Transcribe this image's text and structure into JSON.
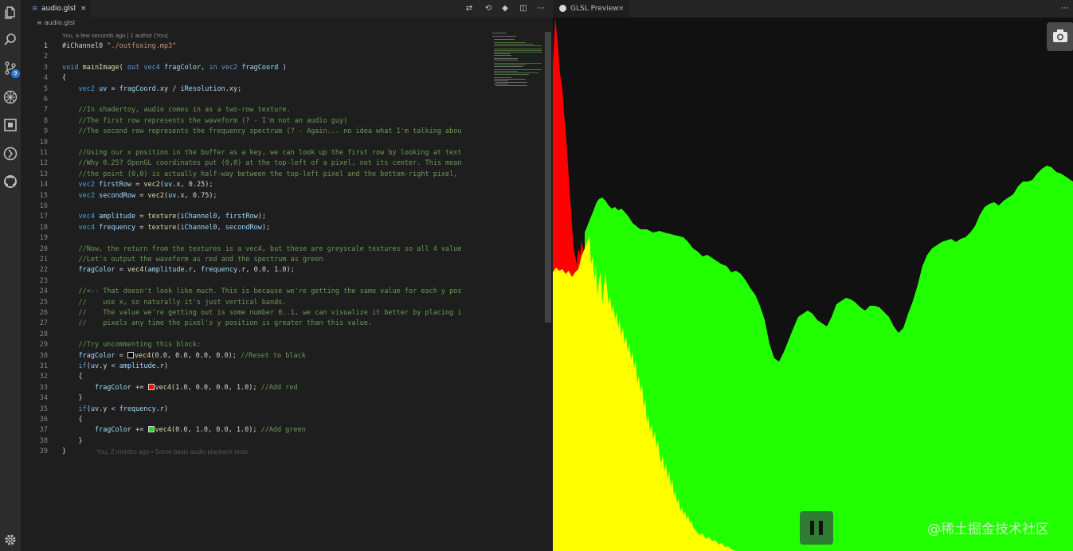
{
  "editor": {
    "tab": {
      "label": "audio.glsl",
      "close": "×"
    },
    "breadcrumb": "audio.glsl",
    "blame": "You, a few seconds ago | 1 author (You)",
    "inline_blame": "You, 2 months ago • Some basic audio playback tests",
    "code_lines": [
      {
        "n": "1",
        "html": "#iChannel0 <span class=\"st\">\"./outfoxing.mp3\"</span>"
      },
      {
        "n": "2",
        "html": ""
      },
      {
        "n": "3",
        "html": "<span class=\"kw\">void</span> <span class=\"fn\">mainImage</span>( <span class=\"kw\">out</span> <span class=\"kw\">vec4</span> <span class=\"vr\">fragColor</span>, <span class=\"kw\">in</span> <span class=\"kw\">vec2</span> <span class=\"vr\">fragCoord</span> )"
      },
      {
        "n": "4",
        "html": "{"
      },
      {
        "n": "5",
        "html": "    <span class=\"kw\">vec2</span> <span class=\"vr\">uv</span> = <span class=\"vr\">fragCoord</span>.xy / <span class=\"vr\">iResolution</span>.xy;"
      },
      {
        "n": "6",
        "html": ""
      },
      {
        "n": "7",
        "html": "    <span class=\"cm\">//In shadertoy, audio comes in as a two-row texture.</span>"
      },
      {
        "n": "8",
        "html": "    <span class=\"cm\">//The first row represents the waveform (? - I'm not an audio guy)</span>"
      },
      {
        "n": "9",
        "html": "    <span class=\"cm\">//The second row represents the frequency spectrum (? - Again... no idea what I'm talking abou</span>"
      },
      {
        "n": "10",
        "html": ""
      },
      {
        "n": "11",
        "html": "    <span class=\"cm\">//Using our x position in the buffer as a key, we can look up the first row by looking at text</span>"
      },
      {
        "n": "12",
        "html": "    <span class=\"cm\">//Why 0.25? OpenGL coordinates put (0,0) at the top-left of a pixel, not its center. This mean</span>"
      },
      {
        "n": "13",
        "html": "    <span class=\"cm\">//the point (0,0) is actually half-way between the top-left pixel and the bottom-right pixel, </span>"
      },
      {
        "n": "14",
        "html": "    <span class=\"kw\">vec2</span> <span class=\"vr\">firstRow</span> = <span class=\"fn\">vec2</span>(<span class=\"vr\">uv</span>.x, 0.25);"
      },
      {
        "n": "15",
        "html": "    <span class=\"kw\">vec2</span> <span class=\"vr\">secondRow</span> = <span class=\"fn\">vec2</span>(<span class=\"vr\">uv</span>.x, 0.75);"
      },
      {
        "n": "16",
        "html": ""
      },
      {
        "n": "17",
        "html": "    <span class=\"kw\">vec4</span> <span class=\"vr\">amplitude</span> = <span class=\"fn\">texture</span>(<span class=\"vr\">iChannel0</span>, <span class=\"vr\">firstRow</span>);"
      },
      {
        "n": "18",
        "html": "    <span class=\"kw\">vec4</span> <span class=\"vr\">frequency</span> = <span class=\"fn\">texture</span>(<span class=\"vr\">iChannel0</span>, <span class=\"vr\">secondRow</span>);"
      },
      {
        "n": "19",
        "html": ""
      },
      {
        "n": "20",
        "html": "    <span class=\"cm\">//Now, the return from the textures is a vec4, but these are greyscale textures so all 4 value</span>"
      },
      {
        "n": "21",
        "html": "    <span class=\"cm\">//Let's output the waveform as red and the spectrum as green</span>"
      },
      {
        "n": "22",
        "html": "    <span class=\"vr\">fragColor</span> = <span class=\"fn\">vec4</span>(<span class=\"vr\">amplitude</span>.r, <span class=\"vr\">frequency</span>.r, 0.0, 1.0);"
      },
      {
        "n": "23",
        "html": ""
      },
      {
        "n": "24",
        "html": "    <span class=\"cm\">//<-- That doesn't look like much. This is because we're getting the same value for each y pos</span>"
      },
      {
        "n": "25",
        "html": "    <span class=\"cm\">//    use x, so naturally it's just vertical bands.</span>"
      },
      {
        "n": "26",
        "html": "    <span class=\"cm\">//    The value we're getting out is some number 0..1, we can visualize it better by placing i</span>"
      },
      {
        "n": "27",
        "html": "    <span class=\"cm\">//    pixels any time the pixel's y position is greater than this value.</span>"
      },
      {
        "n": "28",
        "html": ""
      },
      {
        "n": "29",
        "html": "    <span class=\"cm\">//Try uncommenting this block:</span>"
      },
      {
        "n": "30",
        "html": "    <span class=\"vr\">fragColor</span> = <span class=\"swatch\" style=\"background:#000\"></span><span class=\"fn\">vec4</span>(0.0, 0.0, 0.0, 0.0); <span class=\"cm\">//Reset to black</span>"
      },
      {
        "n": "31",
        "html": "    <span class=\"kw\">if</span>(<span class=\"vr\">uv</span>.y < <span class=\"vr\">amplitude</span>.r)"
      },
      {
        "n": "32",
        "html": "    {"
      },
      {
        "n": "33",
        "html": "        <span class=\"vr\">fragColor</span> += <span class=\"swatch\" style=\"background:#ff0000\"></span><span class=\"fn\">vec4</span>(1.0, 0.0, 0.0, 1.0); <span class=\"cm\">//Add red</span>"
      },
      {
        "n": "34",
        "html": "    }"
      },
      {
        "n": "35",
        "html": "    <span class=\"kw\">if</span>(<span class=\"vr\">uv</span>.y < <span class=\"vr\">frequency</span>.r)"
      },
      {
        "n": "36",
        "html": "    {"
      },
      {
        "n": "37",
        "html": "        <span class=\"vr\">fragColor</span> += <span class=\"swatch\" style=\"background:#22dd22\"></span><span class=\"fn\">vec4</span>(0.0, 1.0, 0.0, 1.0); <span class=\"cm\">//Add green</span>"
      },
      {
        "n": "38",
        "html": "    }"
      },
      {
        "n": "39",
        "html": "}"
      }
    ]
  },
  "preview": {
    "tab": {
      "label": "GLSL Preview",
      "close": "×"
    },
    "watermark": "@稀土掘金技术社区",
    "colors": {
      "red": "#ff0000",
      "yellow": "#ffff00",
      "green": "#22ff00",
      "background": "#111111"
    }
  },
  "icons": {
    "activity": [
      "files-icon",
      "search-icon",
      "source-control-icon",
      "debug-icon",
      "extensions-icon",
      "remote-icon",
      "github-icon",
      "settings-icon"
    ],
    "source_control_badge": "9",
    "editor_actions": [
      "compare-icon",
      "open-changes-icon",
      "git-icon",
      "split-editor-icon",
      "more-actions-icon"
    ]
  }
}
